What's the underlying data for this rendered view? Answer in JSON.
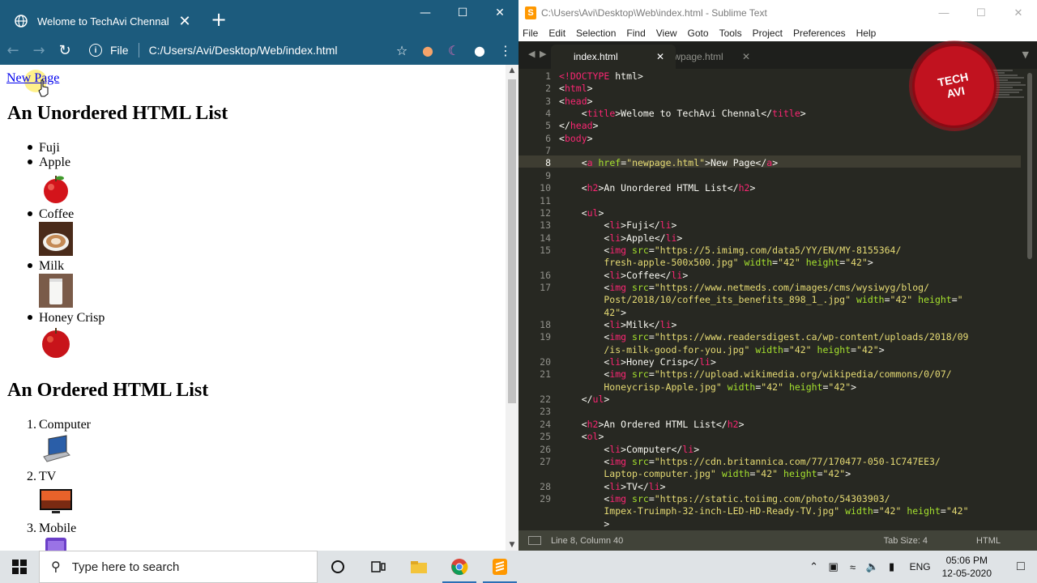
{
  "chrome": {
    "tab_title": "Welome to TechAvi Chennal",
    "tab_close": "✕",
    "new_tab": "+",
    "address_prefix": "File",
    "address_url": "C:/Users/Avi/Desktop/Web/index.html",
    "page": {
      "link_text": "New Page",
      "h2_unordered": "An Unordered HTML List",
      "unordered_items": [
        "Fuji",
        "Apple",
        "Coffee",
        "Milk",
        "Honey Crisp"
      ],
      "h2_ordered": "An Ordered HTML List",
      "ordered_items": [
        "Computer",
        "TV",
        "Mobile"
      ],
      "ordered_numbers": [
        "1.",
        "2.",
        "3."
      ]
    }
  },
  "sublime": {
    "title": "C:\\Users\\Avi\\Desktop\\Web\\index.html - Sublime Text",
    "menu": [
      "File",
      "Edit",
      "Selection",
      "Find",
      "View",
      "Goto",
      "Tools",
      "Project",
      "Preferences",
      "Help"
    ],
    "tabs": [
      {
        "label": "index.html",
        "active": true
      },
      {
        "label": "newpage.html",
        "active": false
      }
    ],
    "line_numbers": [
      "1",
      "2",
      "3",
      "4",
      "5",
      "6",
      "7",
      "8",
      "9",
      "10",
      "11",
      "12",
      "13",
      "14",
      "15",
      "",
      "16",
      "17",
      "",
      "",
      "18",
      "19",
      "",
      "20",
      "21",
      "",
      "22",
      "23",
      "24",
      "25",
      "26",
      "27",
      "",
      "28",
      "29",
      "",
      ""
    ],
    "current_line": "8",
    "code_lines": [
      [
        [
          "t-tag",
          "<!"
        ],
        [
          "t-tag",
          "DOCTYPE"
        ],
        [
          "t-txt",
          " html>"
        ]
      ],
      [
        [
          "t-txt",
          "<"
        ],
        [
          "t-tag",
          "html"
        ],
        [
          "t-txt",
          ">"
        ]
      ],
      [
        [
          "t-txt",
          "<"
        ],
        [
          "t-tag",
          "head"
        ],
        [
          "t-txt",
          ">"
        ]
      ],
      [
        [
          "t-txt",
          "    <"
        ],
        [
          "t-tag",
          "title"
        ],
        [
          "t-txt",
          ">Welome to TechAvi Chennal</"
        ],
        [
          "t-tag",
          "title"
        ],
        [
          "t-txt",
          ">"
        ]
      ],
      [
        [
          "t-txt",
          "</"
        ],
        [
          "t-tag",
          "head"
        ],
        [
          "t-txt",
          ">"
        ]
      ],
      [
        [
          "t-txt",
          "<"
        ],
        [
          "t-tag",
          "body"
        ],
        [
          "t-txt",
          ">"
        ]
      ],
      [
        [
          "t-txt",
          ""
        ]
      ],
      [
        [
          "t-txt",
          "    <"
        ],
        [
          "t-tag",
          "a"
        ],
        [
          "t-txt",
          " "
        ],
        [
          "t-attr",
          "href"
        ],
        [
          "t-txt",
          "="
        ],
        [
          "t-str",
          "\"newpage.html\""
        ],
        [
          "t-txt",
          ">New Page</"
        ],
        [
          "t-tag",
          "a"
        ],
        [
          "t-txt",
          ">"
        ]
      ],
      [
        [
          "t-txt",
          ""
        ]
      ],
      [
        [
          "t-txt",
          "    <"
        ],
        [
          "t-tag",
          "h2"
        ],
        [
          "t-txt",
          ">An Unordered HTML List</"
        ],
        [
          "t-tag",
          "h2"
        ],
        [
          "t-txt",
          ">"
        ]
      ],
      [
        [
          "t-txt",
          ""
        ]
      ],
      [
        [
          "t-txt",
          "    <"
        ],
        [
          "t-tag",
          "ul"
        ],
        [
          "t-txt",
          ">"
        ]
      ],
      [
        [
          "t-txt",
          "        <"
        ],
        [
          "t-tag",
          "li"
        ],
        [
          "t-txt",
          ">Fuji</"
        ],
        [
          "t-tag",
          "li"
        ],
        [
          "t-txt",
          ">"
        ]
      ],
      [
        [
          "t-txt",
          "        <"
        ],
        [
          "t-tag",
          "li"
        ],
        [
          "t-txt",
          ">Apple</"
        ],
        [
          "t-tag",
          "li"
        ],
        [
          "t-txt",
          ">"
        ]
      ],
      [
        [
          "t-txt",
          "        <"
        ],
        [
          "t-tag",
          "img"
        ],
        [
          "t-txt",
          " "
        ],
        [
          "t-attr",
          "src"
        ],
        [
          "t-txt",
          "="
        ],
        [
          "t-str",
          "\"https://5.imimg.com/data5/YY/EN/MY-8155364/"
        ]
      ],
      [
        [
          "t-str",
          "        fresh-apple-500x500.jpg\""
        ],
        [
          "t-txt",
          " "
        ],
        [
          "t-attr",
          "width"
        ],
        [
          "t-txt",
          "="
        ],
        [
          "t-str",
          "\"42\""
        ],
        [
          "t-txt",
          " "
        ],
        [
          "t-attr",
          "height"
        ],
        [
          "t-txt",
          "="
        ],
        [
          "t-str",
          "\"42\""
        ],
        [
          "t-txt",
          ">"
        ]
      ],
      [
        [
          "t-txt",
          "        <"
        ],
        [
          "t-tag",
          "li"
        ],
        [
          "t-txt",
          ">Coffee</"
        ],
        [
          "t-tag",
          "li"
        ],
        [
          "t-txt",
          ">"
        ]
      ],
      [
        [
          "t-txt",
          "        <"
        ],
        [
          "t-tag",
          "img"
        ],
        [
          "t-txt",
          " "
        ],
        [
          "t-attr",
          "src"
        ],
        [
          "t-txt",
          "="
        ],
        [
          "t-str",
          "\"https://www.netmeds.com/images/cms/wysiwyg/blog/"
        ]
      ],
      [
        [
          "t-str",
          "        Post/2018/10/coffee_its_benefits_898_1_.jpg\""
        ],
        [
          "t-txt",
          " "
        ],
        [
          "t-attr",
          "width"
        ],
        [
          "t-txt",
          "="
        ],
        [
          "t-str",
          "\"42\""
        ],
        [
          "t-txt",
          " "
        ],
        [
          "t-attr",
          "height"
        ],
        [
          "t-txt",
          "="
        ],
        [
          "t-str",
          "\""
        ]
      ],
      [
        [
          "t-str",
          "        42\""
        ],
        [
          "t-txt",
          ">"
        ]
      ],
      [
        [
          "t-txt",
          "        <"
        ],
        [
          "t-tag",
          "li"
        ],
        [
          "t-txt",
          ">Milk</"
        ],
        [
          "t-tag",
          "li"
        ],
        [
          "t-txt",
          ">"
        ]
      ],
      [
        [
          "t-txt",
          "        <"
        ],
        [
          "t-tag",
          "img"
        ],
        [
          "t-txt",
          " "
        ],
        [
          "t-attr",
          "src"
        ],
        [
          "t-txt",
          "="
        ],
        [
          "t-str",
          "\"https://www.readersdigest.ca/wp-content/uploads/2018/09"
        ]
      ],
      [
        [
          "t-str",
          "        /is-milk-good-for-you.jpg\""
        ],
        [
          "t-txt",
          " "
        ],
        [
          "t-attr",
          "width"
        ],
        [
          "t-txt",
          "="
        ],
        [
          "t-str",
          "\"42\""
        ],
        [
          "t-txt",
          " "
        ],
        [
          "t-attr",
          "height"
        ],
        [
          "t-txt",
          "="
        ],
        [
          "t-str",
          "\"42\""
        ],
        [
          "t-txt",
          ">"
        ]
      ],
      [
        [
          "t-txt",
          "        <"
        ],
        [
          "t-tag",
          "li"
        ],
        [
          "t-txt",
          ">Honey Crisp</"
        ],
        [
          "t-tag",
          "li"
        ],
        [
          "t-txt",
          ">"
        ]
      ],
      [
        [
          "t-txt",
          "        <"
        ],
        [
          "t-tag",
          "img"
        ],
        [
          "t-txt",
          " "
        ],
        [
          "t-attr",
          "src"
        ],
        [
          "t-txt",
          "="
        ],
        [
          "t-str",
          "\"https://upload.wikimedia.org/wikipedia/commons/0/07/"
        ]
      ],
      [
        [
          "t-str",
          "        Honeycrisp-Apple.jpg\""
        ],
        [
          "t-txt",
          " "
        ],
        [
          "t-attr",
          "width"
        ],
        [
          "t-txt",
          "="
        ],
        [
          "t-str",
          "\"42\""
        ],
        [
          "t-txt",
          " "
        ],
        [
          "t-attr",
          "height"
        ],
        [
          "t-txt",
          "="
        ],
        [
          "t-str",
          "\"42\""
        ],
        [
          "t-txt",
          ">"
        ]
      ],
      [
        [
          "t-txt",
          "    </"
        ],
        [
          "t-tag",
          "ul"
        ],
        [
          "t-txt",
          ">"
        ]
      ],
      [
        [
          "t-txt",
          ""
        ]
      ],
      [
        [
          "t-txt",
          "    <"
        ],
        [
          "t-tag",
          "h2"
        ],
        [
          "t-txt",
          ">An Ordered HTML List</"
        ],
        [
          "t-tag",
          "h2"
        ],
        [
          "t-txt",
          ">"
        ]
      ],
      [
        [
          "t-txt",
          "    <"
        ],
        [
          "t-tag",
          "ol"
        ],
        [
          "t-txt",
          ">"
        ]
      ],
      [
        [
          "t-txt",
          "        <"
        ],
        [
          "t-tag",
          "li"
        ],
        [
          "t-txt",
          ">Computer</"
        ],
        [
          "t-tag",
          "li"
        ],
        [
          "t-txt",
          ">"
        ]
      ],
      [
        [
          "t-txt",
          "        <"
        ],
        [
          "t-tag",
          "img"
        ],
        [
          "t-txt",
          " "
        ],
        [
          "t-attr",
          "src"
        ],
        [
          "t-txt",
          "="
        ],
        [
          "t-str",
          "\"https://cdn.britannica.com/77/170477-050-1C747EE3/"
        ]
      ],
      [
        [
          "t-str",
          "        Laptop-computer.jpg\""
        ],
        [
          "t-txt",
          " "
        ],
        [
          "t-attr",
          "width"
        ],
        [
          "t-txt",
          "="
        ],
        [
          "t-str",
          "\"42\""
        ],
        [
          "t-txt",
          " "
        ],
        [
          "t-attr",
          "height"
        ],
        [
          "t-txt",
          "="
        ],
        [
          "t-str",
          "\"42\""
        ],
        [
          "t-txt",
          ">"
        ]
      ],
      [
        [
          "t-txt",
          "        <"
        ],
        [
          "t-tag",
          "li"
        ],
        [
          "t-txt",
          ">TV</"
        ],
        [
          "t-tag",
          "li"
        ],
        [
          "t-txt",
          ">"
        ]
      ],
      [
        [
          "t-txt",
          "        <"
        ],
        [
          "t-tag",
          "img"
        ],
        [
          "t-txt",
          " "
        ],
        [
          "t-attr",
          "src"
        ],
        [
          "t-txt",
          "="
        ],
        [
          "t-str",
          "\"https://static.toiimg.com/photo/54303903/"
        ]
      ],
      [
        [
          "t-str",
          "        Impex-Truimph-32-inch-LED-HD-Ready-TV.jpg\""
        ],
        [
          "t-txt",
          " "
        ],
        [
          "t-attr",
          "width"
        ],
        [
          "t-txt",
          "="
        ],
        [
          "t-str",
          "\"42\""
        ],
        [
          "t-txt",
          " "
        ],
        [
          "t-attr",
          "height"
        ],
        [
          "t-txt",
          "="
        ],
        [
          "t-str",
          "\"42\""
        ]
      ],
      [
        [
          "t-txt",
          "        >"
        ]
      ]
    ],
    "status_position": "Line 8, Column 40",
    "status_tabsize": "Tab Size: 4",
    "status_syntax": "HTML"
  },
  "badge": {
    "line1": "TECH",
    "line2": "AVI"
  },
  "taskbar": {
    "search_placeholder": "Type here to search",
    "language": "ENG",
    "time": "05:06 PM",
    "date": "12-05-2020"
  },
  "colors": {
    "chrome_frame": "#1c5b7d",
    "sublime_bg": "#272822",
    "tag": "#f92672",
    "attr": "#a6e22e",
    "string": "#e6db74",
    "badge": "#c1121f"
  }
}
